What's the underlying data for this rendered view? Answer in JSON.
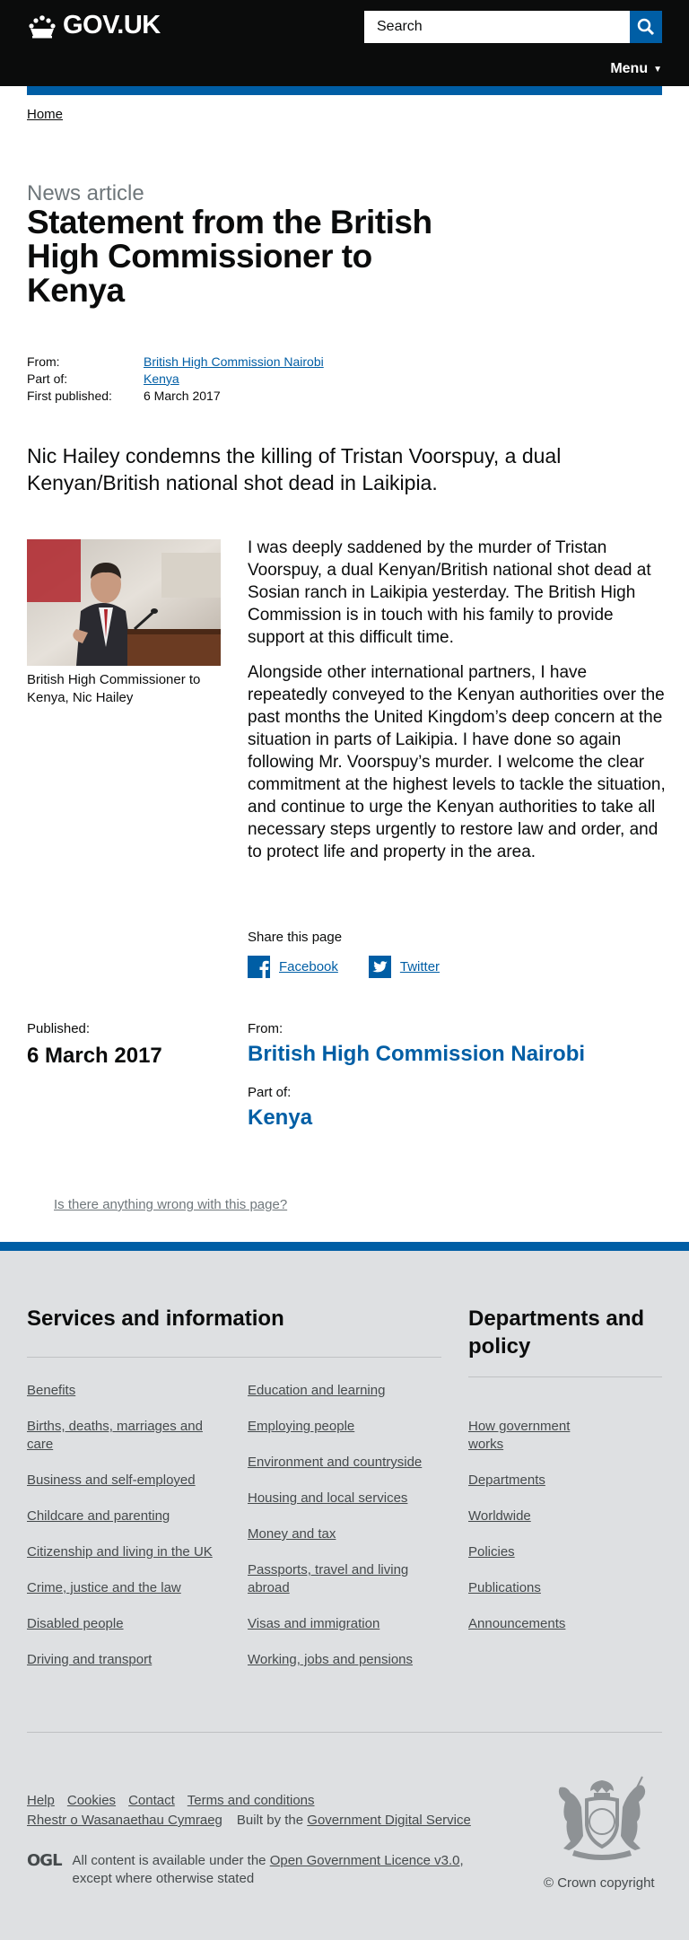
{
  "header": {
    "logo_text": "GOV.UK",
    "search_placeholder": "Search",
    "menu_label": "Menu",
    "accent_color": "#005ea5"
  },
  "breadcrumb": {
    "home": "Home"
  },
  "article": {
    "kicker": "News article",
    "title": "Statement from the British High Commissioner to Kenya",
    "meta": [
      {
        "key": "From:",
        "value": "British High Commission Nairobi",
        "link": true
      },
      {
        "key": "Part of:",
        "value": "Kenya",
        "link": true
      },
      {
        "key": "First published:",
        "value": "6 March 2017",
        "link": false
      }
    ],
    "lead": "Nic Hailey condemns the killing of Tristan Voorspuy, a dual Kenyan/British national shot dead in Laikipia.",
    "image_caption": "British High Commissioner to Kenya, Nic Hailey",
    "paragraphs": [
      "I was deeply saddened by the murder of Tristan Voorspuy, a dual Kenyan/British national shot dead at Sosian ranch in Laikipia yesterday. The British High Commission is in touch with his family to provide support at this difficult time.",
      "Alongside other international partners, I have repeatedly conveyed to the Kenyan authorities over the past months the United Kingdom’s deep concern at the situation in parts of Laikipia. I have done so again following Mr. Voorspuy’s murder. I welcome the clear commitment at the highest levels to tackle the situation, and continue to urge the Kenyan authorities to take all necessary steps urgently to restore law and order, and to protect life and property in the area."
    ]
  },
  "share": {
    "title": "Share this page",
    "facebook": "Facebook",
    "twitter": "Twitter"
  },
  "published": {
    "published_label": "Published:",
    "date": "6 March 2017",
    "from_label": "From:",
    "from_value": "British High Commission Nairobi",
    "partof_label": "Part of:",
    "partof_value": "Kenya"
  },
  "report_link": "Is there anything wrong with this page?",
  "footer": {
    "services_heading": "Services and information",
    "departments_heading": "Departments and policy",
    "services_col1": [
      "Benefits",
      "Births, deaths, marriages and care",
      "Business and self-employed",
      "Childcare and parenting",
      "Citizenship and living in the UK",
      "Crime, justice and the law",
      "Disabled people",
      "Driving and transport"
    ],
    "services_col2": [
      "Education and learning",
      "Employing people",
      "Environment and countryside",
      "Housing and local services",
      "Money and tax",
      "Passports, travel and living abroad",
      "Visas and immigration",
      "Working, jobs and pensions"
    ],
    "departments": [
      "How government works",
      "Departments",
      "Worldwide",
      "Policies",
      "Publications",
      "Announcements"
    ],
    "meta_links": [
      "Help",
      "Cookies",
      "Contact",
      "Terms and conditions"
    ],
    "welsh": "Rhestr o Wasanaethau Cymraeg",
    "built_by_prefix": "Built by the",
    "built_by_link": "Government Digital Service",
    "ogl_badge": "OGL",
    "licence_prefix": "All content is available under the",
    "licence_link": "Open Government Licence v3.0",
    "licence_suffix": ", except where otherwise stated",
    "copyright": "© Crown copyright"
  }
}
